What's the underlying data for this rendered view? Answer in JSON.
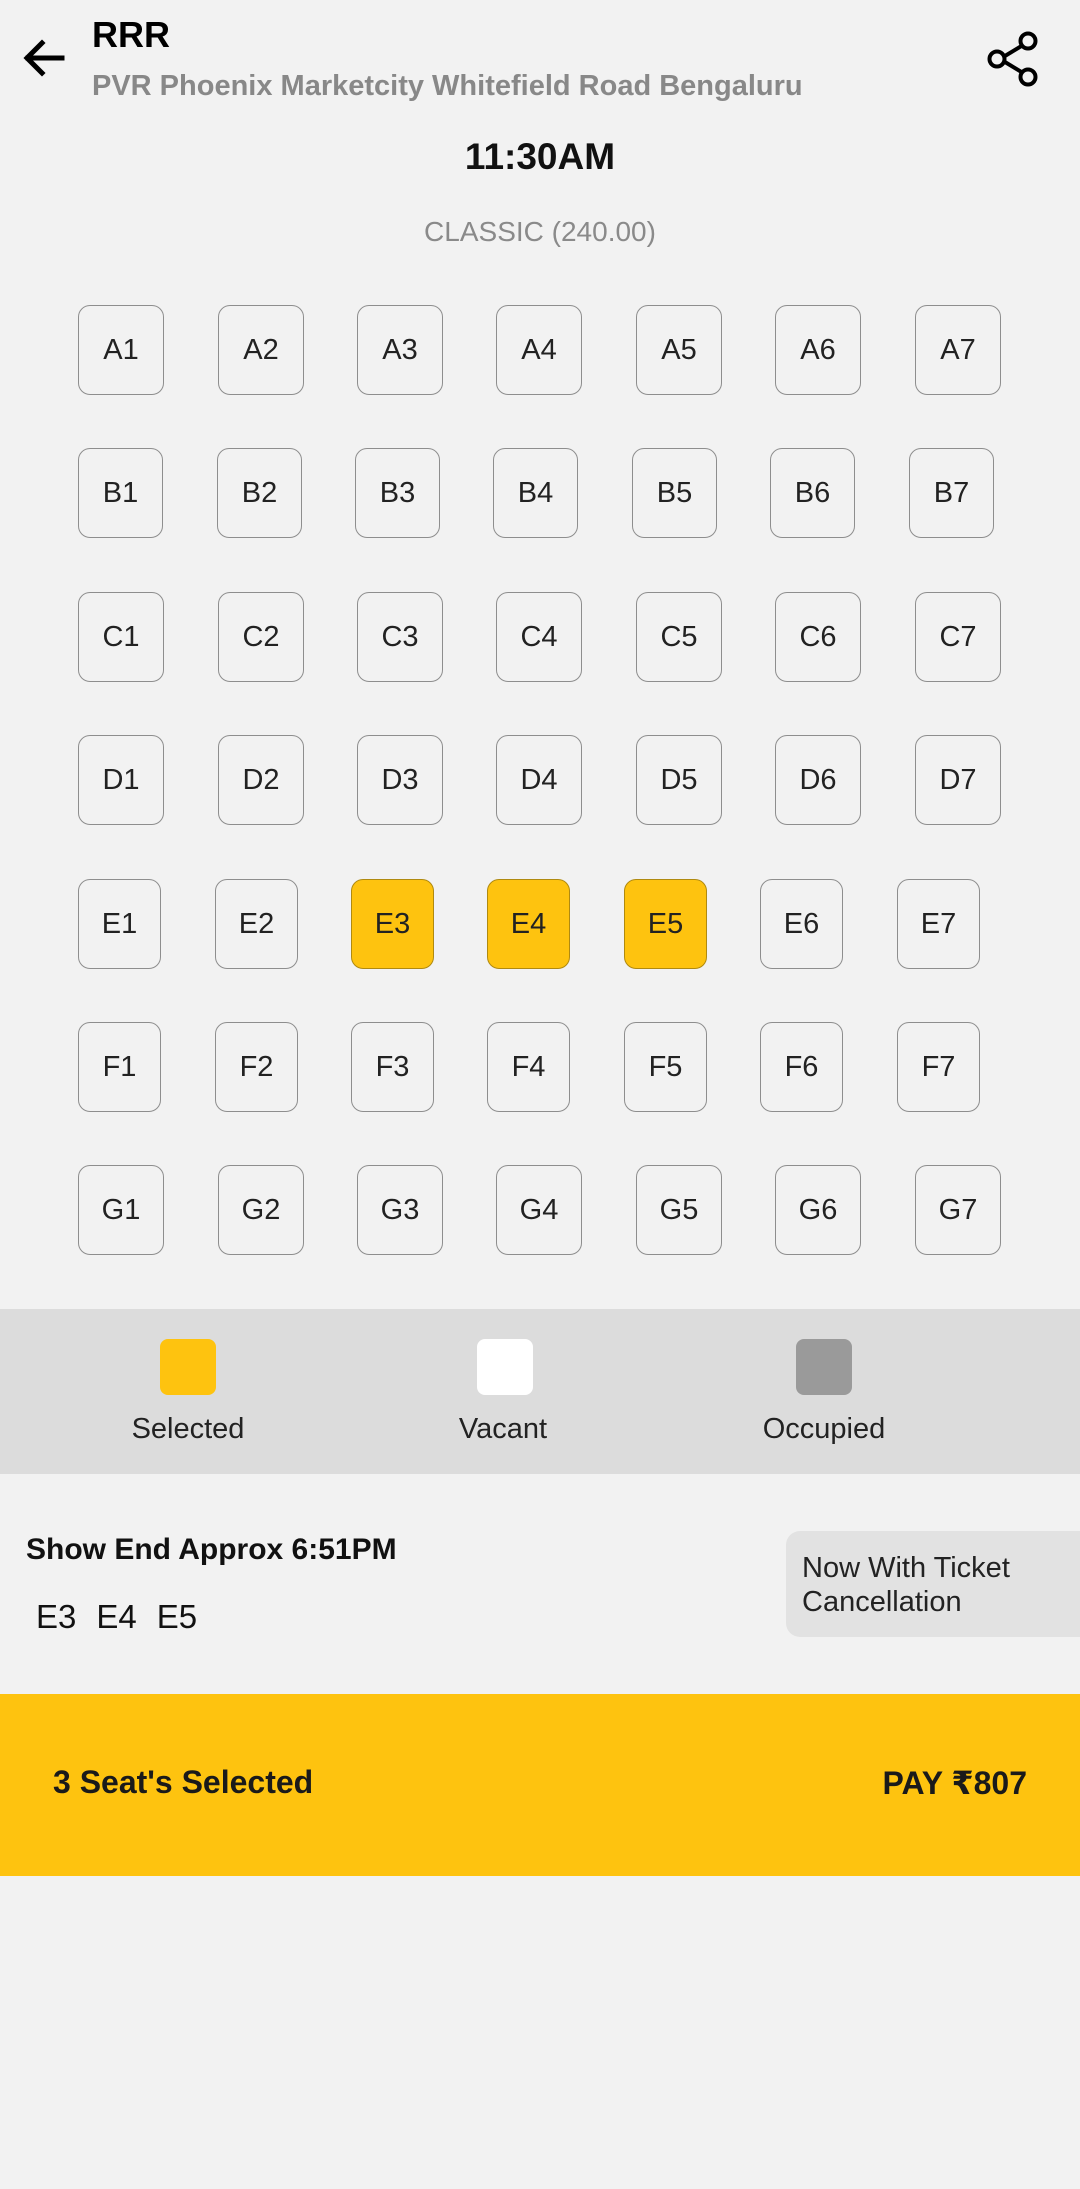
{
  "header": {
    "title": "RRR",
    "subtitle": "PVR Phoenix Marketcity Whitefield Road Bengaluru",
    "back_icon": "arrow-left-icon",
    "share_icon": "share-icon"
  },
  "showtime": "11:30AM",
  "category": "CLASSIC (240.00)",
  "seats": {
    "rows": [
      [
        "A1",
        "A2",
        "A3",
        "A4",
        "A5",
        "A6",
        "A7"
      ],
      [
        "B1",
        "B2",
        "B3",
        "B4",
        "B5",
        "B6",
        "B7"
      ],
      [
        "C1",
        "C2",
        "C3",
        "C4",
        "C5",
        "C6",
        "C7"
      ],
      [
        "D1",
        "D2",
        "D3",
        "D4",
        "D5",
        "D6",
        "D7"
      ],
      [
        "E1",
        "E2",
        "E3",
        "E4",
        "E5",
        "E6",
        "E7"
      ],
      [
        "F1",
        "F2",
        "F3",
        "F4",
        "F5",
        "F6",
        "F7"
      ],
      [
        "G1",
        "G2",
        "G3",
        "G4",
        "G5",
        "G6",
        "G7"
      ]
    ],
    "selected": [
      "E3",
      "E4",
      "E5"
    ]
  },
  "legend": [
    {
      "label": "Selected",
      "color": "#fec30f"
    },
    {
      "label": "Vacant",
      "color": "#ffffff"
    },
    {
      "label": "Occupied",
      "color": "#9a9a9a"
    }
  ],
  "summary": {
    "show_end": "Show End Approx 6:51PM",
    "selected_seats": [
      "E3",
      "E4",
      "E5"
    ],
    "cancellation_note": "Now With Ticket Cancellation"
  },
  "pay_bar": {
    "count_label": "3 Seat's Selected",
    "pay_label": "PAY ₹807"
  },
  "colors": {
    "accent": "#fec30f",
    "background": "#f2f2f2"
  }
}
